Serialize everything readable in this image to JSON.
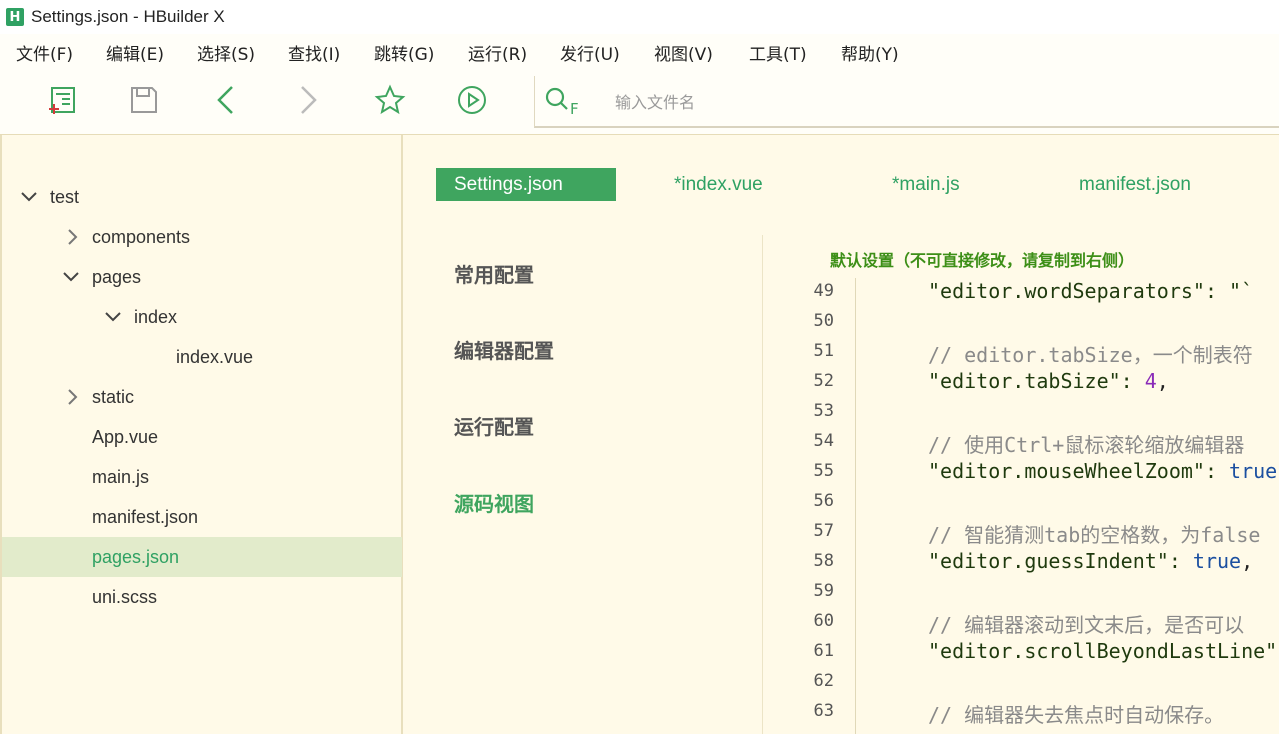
{
  "window": {
    "title": "Settings.json - HBuilder X",
    "logo_letter": "H"
  },
  "menu": [
    "文件(F)",
    "编辑(E)",
    "选择(S)",
    "查找(I)",
    "跳转(G)",
    "运行(R)",
    "发行(U)",
    "视图(V)",
    "工具(T)",
    "帮助(Y)"
  ],
  "toolbar": {
    "icons": [
      "new-file-icon",
      "save-icon",
      "back-icon",
      "forward-icon",
      "favorite-star-icon",
      "run-play-icon"
    ],
    "search_placeholder": "输入文件名",
    "search_icon_label": "F"
  },
  "tree": {
    "items": [
      {
        "label": "test",
        "chevron": "down"
      },
      {
        "label": "components",
        "chevron": "right"
      },
      {
        "label": "pages",
        "chevron": "down"
      },
      {
        "label": "index",
        "chevron": "down"
      },
      {
        "label": "index.vue",
        "chevron": ""
      },
      {
        "label": "static",
        "chevron": "right"
      },
      {
        "label": "App.vue",
        "chevron": ""
      },
      {
        "label": "main.js",
        "chevron": ""
      },
      {
        "label": "manifest.json",
        "chevron": ""
      },
      {
        "label": "pages.json",
        "chevron": "",
        "selected": true
      },
      {
        "label": "uni.scss",
        "chevron": ""
      }
    ]
  },
  "tabs": [
    {
      "label": "Settings.json",
      "active": true
    },
    {
      "label": "*index.vue",
      "active": false
    },
    {
      "label": "*main.js",
      "active": false
    },
    {
      "label": "manifest.json",
      "active": false
    }
  ],
  "settings_nav": [
    {
      "label": "常用配置",
      "active": false
    },
    {
      "label": "编辑器配置",
      "active": false
    },
    {
      "label": "运行配置",
      "active": false
    },
    {
      "label": "源码视图",
      "active": true
    }
  ],
  "code_header": "默认设置（不可直接修改，请复制到右侧）",
  "code_lines": [
    {
      "ln": "49",
      "text": "\"editor.wordSeparators\": \"`",
      "kind": "key"
    },
    {
      "ln": "50",
      "text": "",
      "kind": "blank"
    },
    {
      "ln": "51",
      "text": "// editor.tabSize，一个制表符",
      "kind": "comment"
    },
    {
      "ln": "52",
      "key": "\"editor.tabSize\": ",
      "value": "4",
      "tail": ",",
      "kind": "num"
    },
    {
      "ln": "53",
      "text": "",
      "kind": "blank"
    },
    {
      "ln": "54",
      "text": "// 使用Ctrl+鼠标滚轮缩放编辑器",
      "kind": "comment"
    },
    {
      "ln": "55",
      "key": "\"editor.mouseWheelZoom\": ",
      "value": "true",
      "tail": "",
      "kind": "bool"
    },
    {
      "ln": "56",
      "text": "",
      "kind": "blank"
    },
    {
      "ln": "57",
      "text": "// 智能猜测tab的空格数，为false",
      "kind": "comment"
    },
    {
      "ln": "58",
      "key": "\"editor.guessIndent\": ",
      "value": "true",
      "tail": ",",
      "kind": "bool"
    },
    {
      "ln": "59",
      "text": "",
      "kind": "blank"
    },
    {
      "ln": "60",
      "text": "// 编辑器滚动到文末后，是否可以",
      "kind": "comment"
    },
    {
      "ln": "61",
      "text": "\"editor.scrollBeyondLastLine\"",
      "kind": "key"
    },
    {
      "ln": "62",
      "text": "",
      "kind": "blank"
    },
    {
      "ln": "63",
      "text": "// 编辑器失去焦点时自动保存。",
      "kind": "comment"
    }
  ],
  "colors": {
    "accent": "#2fa163",
    "tab_active_bg": "#3fa55f",
    "sidebar_bg": "#fffae8",
    "selected_row": "#e2ebcb"
  }
}
